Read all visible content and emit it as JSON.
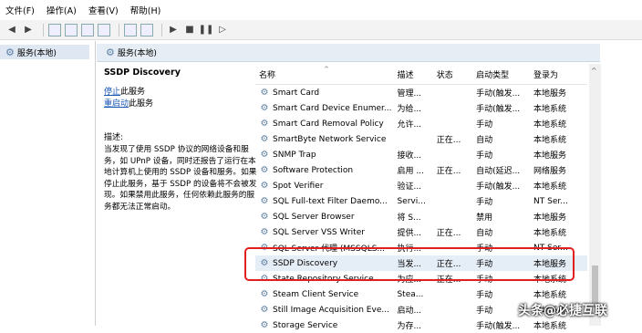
{
  "menu": [
    "文件(F)",
    "操作(A)",
    "查看(V)",
    "帮助(H)"
  ],
  "tree": {
    "item": "服务(本地)"
  },
  "panel": {
    "header": "服务(本地)"
  },
  "details": {
    "title": "SSDP Discovery",
    "stop_link": "停止",
    "stop_suffix": "此服务",
    "restart_link": "重启动",
    "restart_suffix": "此服务",
    "desc_label": "描述:",
    "description": "当发现了使用 SSDP 协议的网络设备和服务，如 UPnP 设备，同时还报告了运行在本地计算机上使用的 SSDP 设备和服务。如果停止此服务，基于 SSDP 的设备将不会被发现。如果禁用此服务，任何依赖此服务的服务都无法正常启动。"
  },
  "columns": [
    "名称",
    "描述",
    "状态",
    "启动类型",
    "登录为"
  ],
  "rows": [
    {
      "name": "Smart Card",
      "desc": "管理...",
      "status": "",
      "startup": "手动(触发...",
      "logon": "本地服务"
    },
    {
      "name": "Smart Card Device Enumer...",
      "desc": "为给...",
      "status": "",
      "startup": "手动(触发...",
      "logon": "本地系统"
    },
    {
      "name": "Smart Card Removal Policy",
      "desc": "允许...",
      "status": "",
      "startup": "手动",
      "logon": "本地系统"
    },
    {
      "name": "SmartByte Network Service",
      "desc": "",
      "status": "正在...",
      "startup": "自动",
      "logon": "本地系统"
    },
    {
      "name": "SNMP Trap",
      "desc": "接收...",
      "status": "",
      "startup": "手动",
      "logon": "本地服务"
    },
    {
      "name": "Software Protection",
      "desc": "启用 ...",
      "status": "正在...",
      "startup": "自动(延迟...",
      "logon": "网络服务"
    },
    {
      "name": "Spot Verifier",
      "desc": "验证...",
      "status": "",
      "startup": "手动(触发...",
      "logon": "本地系统"
    },
    {
      "name": "SQL Full-text Filter Daemo...",
      "desc": "Servi...",
      "status": "",
      "startup": "手动",
      "logon": "NT Ser..."
    },
    {
      "name": "SQL Server Browser",
      "desc": "将 S...",
      "status": "",
      "startup": "禁用",
      "logon": "本地服务"
    },
    {
      "name": "SQL Server VSS Writer",
      "desc": "提供...",
      "status": "正在...",
      "startup": "自动",
      "logon": "本地系统"
    },
    {
      "name": "SQL Server 代理 (MSSQLS...",
      "desc": "执行...",
      "status": "",
      "startup": "手动",
      "logon": "NT Ser..."
    },
    {
      "name": "SSDP Discovery",
      "desc": "当发...",
      "status": "正在...",
      "startup": "手动",
      "logon": "本地服务"
    },
    {
      "name": "State Repository Service",
      "desc": "为应...",
      "status": "正在...",
      "startup": "手动",
      "logon": "本地系统"
    },
    {
      "name": "Steam Client Service",
      "desc": "Stea...",
      "status": "",
      "startup": "手动",
      "logon": "本地系统"
    },
    {
      "name": "Still Image Acquisition Eve...",
      "desc": "启动...",
      "status": "",
      "startup": "手动",
      "logon": "本地系统"
    },
    {
      "name": "Storage Service",
      "desc": "为存...",
      "status": "",
      "startup": "手动(触发...",
      "logon": "本地系统"
    }
  ],
  "watermark": "头条@必捷互联",
  "colors": {
    "highlight": "#e02020",
    "selected_row": "#e5edf7",
    "link": "#1a57b5"
  }
}
